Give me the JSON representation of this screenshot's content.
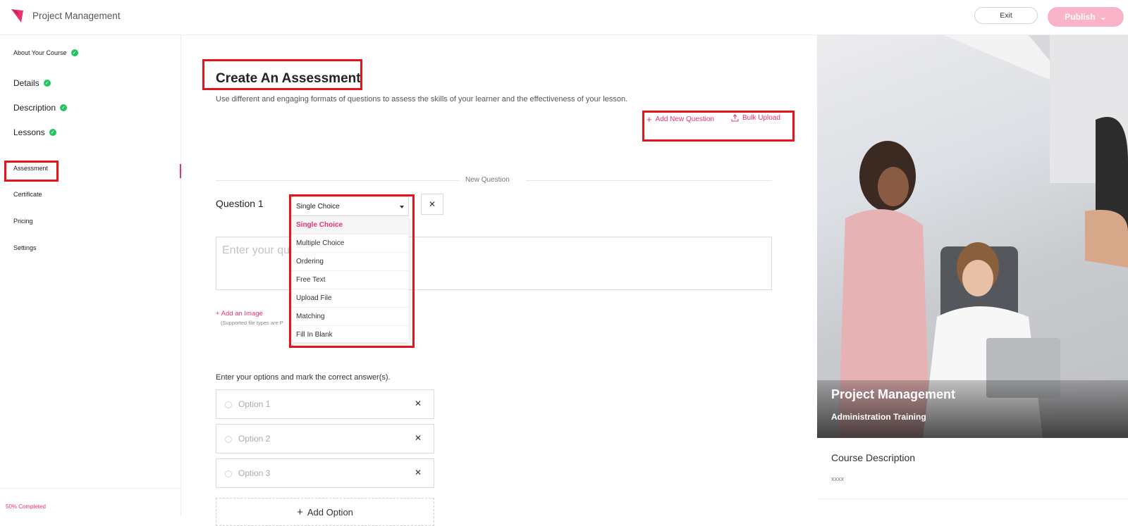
{
  "app": {
    "title": "Project Management"
  },
  "header": {
    "exit_label": "Exit",
    "publish_label": "Publish"
  },
  "sidebar": {
    "items": [
      {
        "label": "About Your Course",
        "done": true
      },
      {
        "label": "Details",
        "done": true
      },
      {
        "label": "Description",
        "done": true
      },
      {
        "label": "Lessons",
        "done": true
      },
      {
        "label": "Assessment",
        "done": false
      },
      {
        "label": "Certificate",
        "done": false
      },
      {
        "label": "Pricing",
        "done": false
      },
      {
        "label": "Settings",
        "done": false
      }
    ],
    "progress_label": "50% Completed",
    "progress": 0.5
  },
  "main": {
    "title": "Create An Assessment",
    "description": "Use different and engaging formats of questions to assess the skills of your learner and the effectiveness of your lesson.",
    "add_question_label": "Add New Question",
    "bulk_upload_label": "Bulk Upload",
    "divider_label": "New Question",
    "question": {
      "label": "Question 1",
      "type_selected": "Single Choice",
      "placeholder": "Enter your qu",
      "add_image_label": "+ Add an Image",
      "file_types_note": "(Supported file types are P"
    },
    "dropdown_options": [
      "Single Choice",
      "Multiple Choice",
      "Ordering",
      "Free Text",
      "Upload File",
      "Matching",
      "Fill In Blank"
    ],
    "options_prompt": "Enter your options and mark the correct answer(s).",
    "options": [
      "Option 1",
      "Option 2",
      "Option 3"
    ],
    "add_option_label": "Add Option"
  },
  "preview": {
    "title": "Project Management",
    "subtitle": "Administration Training",
    "desc_label": "Course Description",
    "desc_value": "xxxx"
  },
  "colors": {
    "accent": "#e8336d",
    "publish": "#f9b4c8",
    "success": "#22c55e",
    "highlight": "#e3141b"
  }
}
